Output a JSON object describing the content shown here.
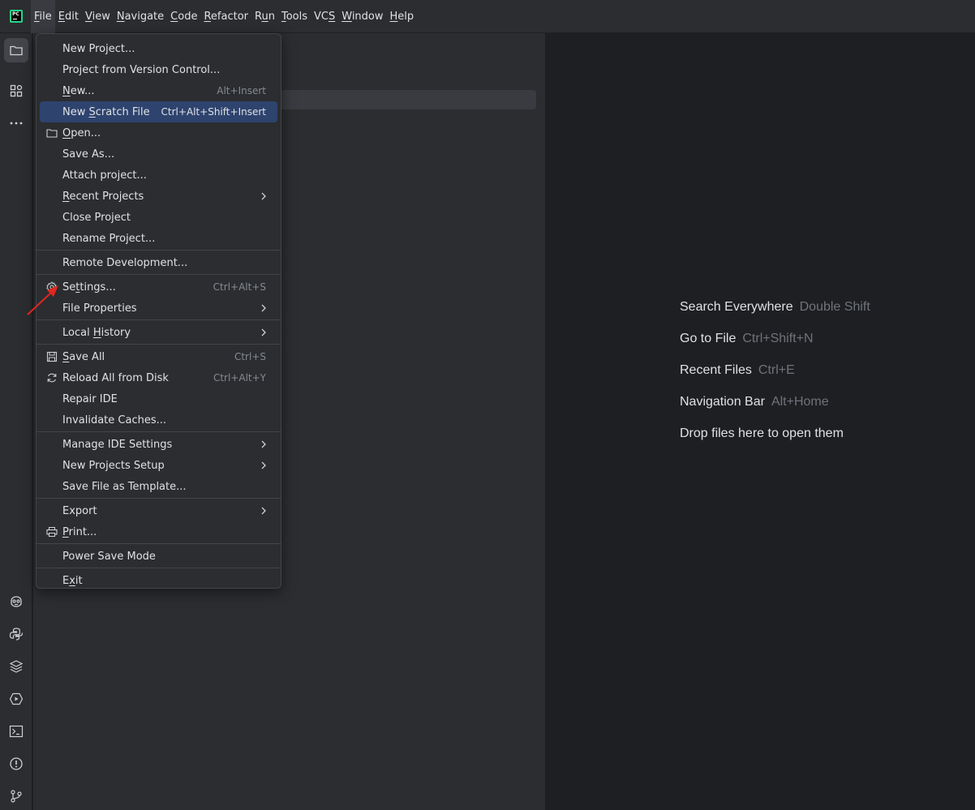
{
  "menubar": {
    "logo_text": "PC",
    "items": [
      {
        "label": "File",
        "u": 0
      },
      {
        "label": "Edit",
        "u": 0
      },
      {
        "label": "View",
        "u": 0
      },
      {
        "label": "Navigate",
        "u": 0
      },
      {
        "label": "Code",
        "u": 0
      },
      {
        "label": "Refactor",
        "u": 0
      },
      {
        "label": "Run",
        "u": 1
      },
      {
        "label": "Tools",
        "u": 0
      },
      {
        "label": "VCS",
        "u": 2
      },
      {
        "label": "Window",
        "u": 0
      },
      {
        "label": "Help",
        "u": 0
      }
    ]
  },
  "toolstrip": {
    "top": [
      "folder-icon",
      "structure-icon",
      "more-icon"
    ],
    "bottom": [
      "copilot-icon",
      "python-console-icon",
      "layers-icon",
      "services-icon",
      "terminal-icon",
      "problems-icon",
      "git-icon"
    ]
  },
  "file_menu": {
    "groups": [
      [
        {
          "label": "New Project...",
          "shortcut": "",
          "arrow": false,
          "icon": ""
        },
        {
          "label": "Project from Version Control...",
          "shortcut": "",
          "arrow": false,
          "icon": ""
        },
        {
          "label": "New...",
          "shortcut": "Alt+Insert",
          "arrow": false,
          "icon": "",
          "u": 0
        },
        {
          "label": "New Scratch File",
          "shortcut": "Ctrl+Alt+Shift+Insert",
          "arrow": false,
          "icon": "",
          "highlight": true,
          "u": 4
        },
        {
          "label": "Open...",
          "shortcut": "",
          "arrow": false,
          "icon": "folder-icon",
          "u": 0
        },
        {
          "label": "Save As...",
          "shortcut": "",
          "arrow": false,
          "icon": ""
        },
        {
          "label": "Attach project...",
          "shortcut": "",
          "arrow": false,
          "icon": ""
        },
        {
          "label": "Recent Projects",
          "shortcut": "",
          "arrow": true,
          "icon": "",
          "u": 0
        },
        {
          "label": "Close Project",
          "shortcut": "",
          "arrow": false,
          "icon": ""
        },
        {
          "label": "Rename Project...",
          "shortcut": "",
          "arrow": false,
          "icon": ""
        }
      ],
      [
        {
          "label": "Remote Development...",
          "shortcut": "",
          "arrow": false,
          "icon": ""
        }
      ],
      [
        {
          "label": "Settings...",
          "shortcut": "Ctrl+Alt+S",
          "arrow": false,
          "icon": "gear-icon",
          "u": 2
        },
        {
          "label": "File Properties",
          "shortcut": "",
          "arrow": true,
          "icon": ""
        }
      ],
      [
        {
          "label": "Local History",
          "shortcut": "",
          "arrow": true,
          "icon": "",
          "u": 6
        }
      ],
      [
        {
          "label": "Save All",
          "shortcut": "Ctrl+S",
          "arrow": false,
          "icon": "save-icon",
          "u": 0
        },
        {
          "label": "Reload All from Disk",
          "shortcut": "Ctrl+Alt+Y",
          "arrow": false,
          "icon": "reload-icon"
        },
        {
          "label": "Repair IDE",
          "shortcut": "",
          "arrow": false,
          "icon": ""
        },
        {
          "label": "Invalidate Caches...",
          "shortcut": "",
          "arrow": false,
          "icon": ""
        }
      ],
      [
        {
          "label": "Manage IDE Settings",
          "shortcut": "",
          "arrow": true,
          "icon": ""
        },
        {
          "label": "New Projects Setup",
          "shortcut": "",
          "arrow": true,
          "icon": ""
        },
        {
          "label": "Save File as Template...",
          "shortcut": "",
          "arrow": false,
          "icon": ""
        }
      ],
      [
        {
          "label": "Export",
          "shortcut": "",
          "arrow": true,
          "icon": ""
        },
        {
          "label": "Print...",
          "shortcut": "",
          "arrow": false,
          "icon": "print-icon",
          "u": 0
        }
      ],
      [
        {
          "label": "Power Save Mode",
          "shortcut": "",
          "arrow": false,
          "icon": ""
        }
      ],
      [
        {
          "label": "Exit",
          "shortcut": "",
          "arrow": false,
          "icon": "",
          "u": 1
        }
      ]
    ]
  },
  "editor_hints": [
    {
      "label": "Search Everywhere",
      "key": "Double Shift"
    },
    {
      "label": "Go to File",
      "key": "Ctrl+Shift+N"
    },
    {
      "label": "Recent Files",
      "key": "Ctrl+E"
    },
    {
      "label": "Navigation Bar",
      "key": "Alt+Home"
    },
    {
      "label": "Drop files here to open them",
      "key": ""
    }
  ],
  "colors": {
    "background": "#1e1f22",
    "panel": "#2b2d30",
    "highlight": "#2e436e",
    "annotation": "#e0281f"
  }
}
